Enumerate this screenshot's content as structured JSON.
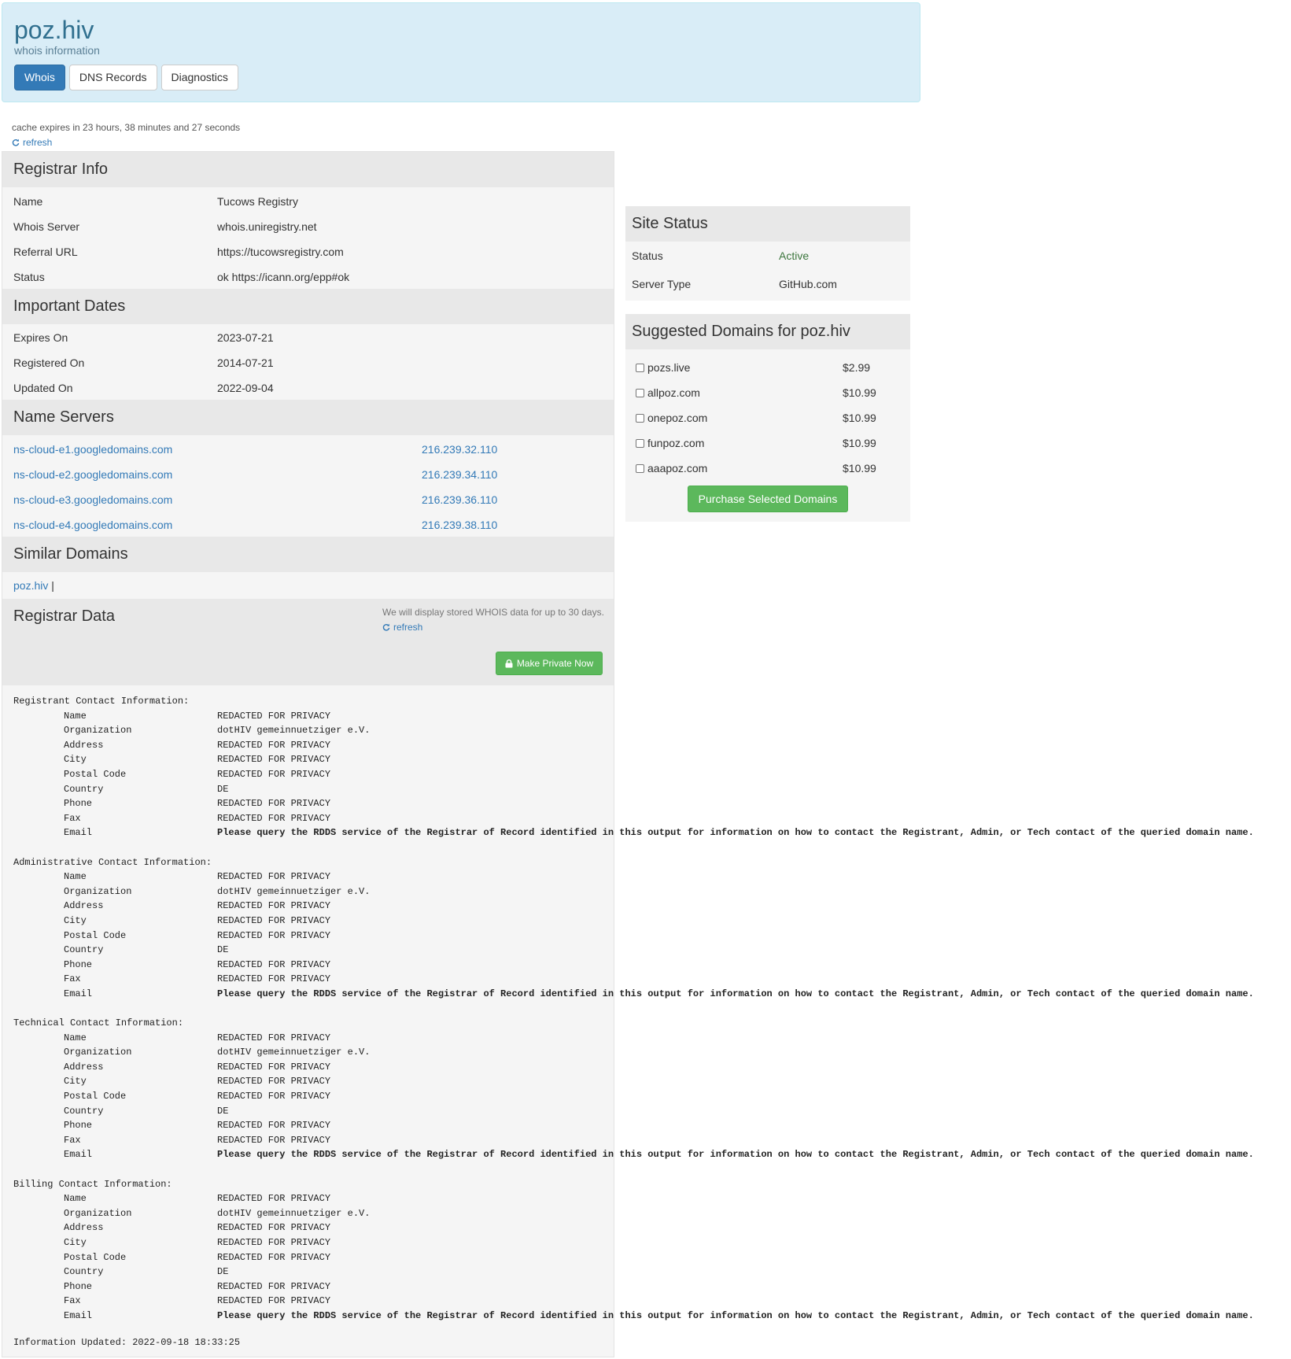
{
  "header": {
    "title": "poz.hiv",
    "subtitle": "whois information",
    "tabs": [
      "Whois",
      "DNS Records",
      "Diagnostics"
    ]
  },
  "cache": {
    "text": "cache expires in 23 hours, 38 minutes and 27 seconds",
    "refresh": "refresh"
  },
  "registrar_info": {
    "title": "Registrar Info",
    "rows": [
      {
        "label": "Name",
        "value": "Tucows Registry"
      },
      {
        "label": "Whois Server",
        "value": "whois.uniregistry.net"
      },
      {
        "label": "Referral URL",
        "value": "https://tucowsregistry.com"
      },
      {
        "label": "Status",
        "value": "ok https://icann.org/epp#ok"
      }
    ]
  },
  "important_dates": {
    "title": "Important Dates",
    "rows": [
      {
        "label": "Expires On",
        "value": "2023-07-21"
      },
      {
        "label": "Registered On",
        "value": "2014-07-21"
      },
      {
        "label": "Updated On",
        "value": "2022-09-04"
      }
    ]
  },
  "name_servers": {
    "title": "Name Servers",
    "rows": [
      {
        "host": "ns-cloud-e1.googledomains.com",
        "ip": "216.239.32.110"
      },
      {
        "host": "ns-cloud-e2.googledomains.com",
        "ip": "216.239.34.110"
      },
      {
        "host": "ns-cloud-e3.googledomains.com",
        "ip": "216.239.36.110"
      },
      {
        "host": "ns-cloud-e4.googledomains.com",
        "ip": "216.239.38.110"
      }
    ]
  },
  "similar_domains": {
    "title": "Similar Domains",
    "link": "poz.hiv",
    "separator": "|"
  },
  "registrar_data": {
    "title": "Registrar Data",
    "note": "We will display stored WHOIS data for up to 30 days.",
    "refresh": "refresh",
    "make_private": "Make Private Now",
    "info_updated": "Information Updated: 2022-09-18 18:33:25",
    "email_note": "Please query the RDDS service of the Registrar of Record identified in this output for information on how to contact the Registrant, Admin, or Tech contact of the queried domain name.",
    "sections": [
      {
        "heading": "Registrant Contact Information:",
        "fields": [
          {
            "key": "Name",
            "value": "REDACTED FOR PRIVACY"
          },
          {
            "key": "Organization",
            "value": "dotHIV gemeinnuetziger e.V."
          },
          {
            "key": "Address",
            "value": "REDACTED FOR PRIVACY"
          },
          {
            "key": "City",
            "value": "REDACTED FOR PRIVACY"
          },
          {
            "key": "Postal Code",
            "value": "REDACTED FOR PRIVACY"
          },
          {
            "key": "Country",
            "value": "DE"
          },
          {
            "key": "Phone",
            "value": "REDACTED FOR PRIVACY"
          },
          {
            "key": "Fax",
            "value": "REDACTED FOR PRIVACY"
          }
        ],
        "email_key": "Email"
      },
      {
        "heading": "Administrative Contact Information:",
        "fields": [
          {
            "key": "Name",
            "value": "REDACTED FOR PRIVACY"
          },
          {
            "key": "Organization",
            "value": "dotHIV gemeinnuetziger e.V."
          },
          {
            "key": "Address",
            "value": "REDACTED FOR PRIVACY"
          },
          {
            "key": "City",
            "value": "REDACTED FOR PRIVACY"
          },
          {
            "key": "Postal Code",
            "value": "REDACTED FOR PRIVACY"
          },
          {
            "key": "Country",
            "value": "DE"
          },
          {
            "key": "Phone",
            "value": "REDACTED FOR PRIVACY"
          },
          {
            "key": "Fax",
            "value": "REDACTED FOR PRIVACY"
          }
        ],
        "email_key": "Email"
      },
      {
        "heading": "Technical Contact Information:",
        "fields": [
          {
            "key": "Name",
            "value": "REDACTED FOR PRIVACY"
          },
          {
            "key": "Organization",
            "value": "dotHIV gemeinnuetziger e.V."
          },
          {
            "key": "Address",
            "value": "REDACTED FOR PRIVACY"
          },
          {
            "key": "City",
            "value": "REDACTED FOR PRIVACY"
          },
          {
            "key": "Postal Code",
            "value": "REDACTED FOR PRIVACY"
          },
          {
            "key": "Country",
            "value": "DE"
          },
          {
            "key": "Phone",
            "value": "REDACTED FOR PRIVACY"
          },
          {
            "key": "Fax",
            "value": "REDACTED FOR PRIVACY"
          }
        ],
        "email_key": "Email"
      },
      {
        "heading": "Billing Contact Information:",
        "fields": [
          {
            "key": "Name",
            "value": "REDACTED FOR PRIVACY"
          },
          {
            "key": "Organization",
            "value": "dotHIV gemeinnuetziger e.V."
          },
          {
            "key": "Address",
            "value": "REDACTED FOR PRIVACY"
          },
          {
            "key": "City",
            "value": "REDACTED FOR PRIVACY"
          },
          {
            "key": "Postal Code",
            "value": "REDACTED FOR PRIVACY"
          },
          {
            "key": "Country",
            "value": "DE"
          },
          {
            "key": "Phone",
            "value": "REDACTED FOR PRIVACY"
          },
          {
            "key": "Fax",
            "value": "REDACTED FOR PRIVACY"
          }
        ],
        "email_key": "Email"
      }
    ]
  },
  "site_status": {
    "title": "Site Status",
    "rows": [
      {
        "label": "Status",
        "value": "Active"
      },
      {
        "label": "Server Type",
        "value": "GitHub.com"
      }
    ],
    "active_color": "#3c763d"
  },
  "suggested": {
    "title": "Suggested Domains for poz.hiv",
    "items": [
      {
        "domain": "pozs.live",
        "price": "$2.99"
      },
      {
        "domain": "allpoz.com",
        "price": "$10.99"
      },
      {
        "domain": "onepoz.com",
        "price": "$10.99"
      },
      {
        "domain": "funpoz.com",
        "price": "$10.99"
      },
      {
        "domain": "aaapoz.com",
        "price": "$10.99"
      }
    ],
    "purchase": "Purchase Selected Domains"
  },
  "colors": {
    "accent": "#337ab7",
    "header_bg": "#d9edf7",
    "success": "#5cb85c"
  }
}
